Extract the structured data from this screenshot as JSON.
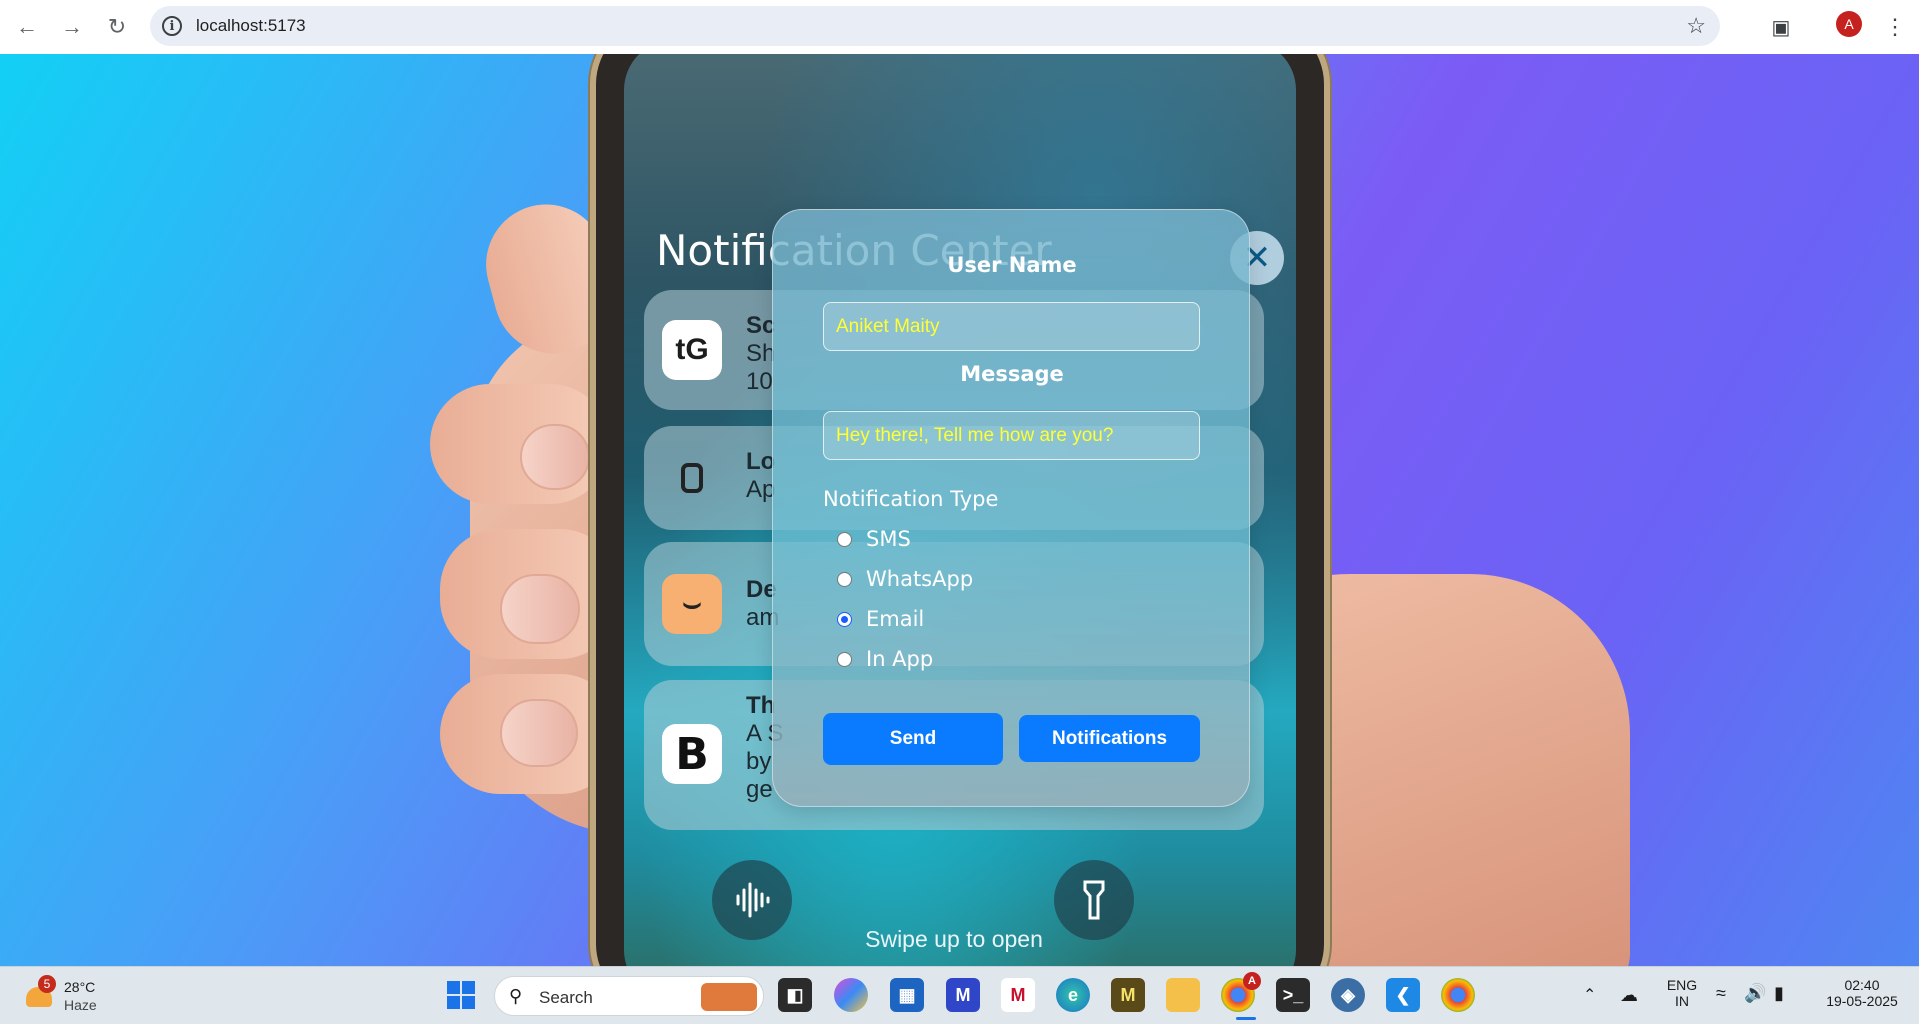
{
  "browser": {
    "url": "localhost:5173",
    "profile_initial": "A"
  },
  "phone": {
    "title": "Notification Center",
    "swipe_text": "Swipe up to open",
    "notifications": [
      {
        "title": "Sc",
        "lines": [
          "Sh",
          "10"
        ],
        "icon_text": "tG"
      },
      {
        "title": "Lo",
        "lines": [
          "Ap"
        ],
        "icon_text": "watch"
      },
      {
        "title": "De",
        "lines": [
          "am"
        ],
        "icon_text": "amazon"
      },
      {
        "title": "Th",
        "lines": [
          "A S",
          "by",
          "ge"
        ],
        "icon_text": "B"
      }
    ]
  },
  "form": {
    "username_label": "User Name",
    "username_value": "Aniket Maity",
    "message_label": "Message",
    "message_value": "Hey there!, Tell me how are you?",
    "type_label": "Notification Type",
    "options": [
      {
        "label": "SMS",
        "checked": false
      },
      {
        "label": "WhatsApp",
        "checked": false
      },
      {
        "label": "Email",
        "checked": true
      },
      {
        "label": "In App",
        "checked": false
      }
    ],
    "send_label": "Send",
    "notifications_label": "Notifications"
  },
  "taskbar": {
    "weather_badge": "5",
    "temperature": "28°C",
    "condition": "Haze",
    "search_text": "Search",
    "language_line1": "ENG",
    "language_line2": "IN",
    "time": "02:40",
    "date": "19-05-2025",
    "chrome_badge": "A"
  },
  "colors": {
    "accent_button": "#0a7bff",
    "input_text": "#ffff33",
    "background_gradient": [
      "#12d0f5",
      "#7b5cf5"
    ]
  }
}
